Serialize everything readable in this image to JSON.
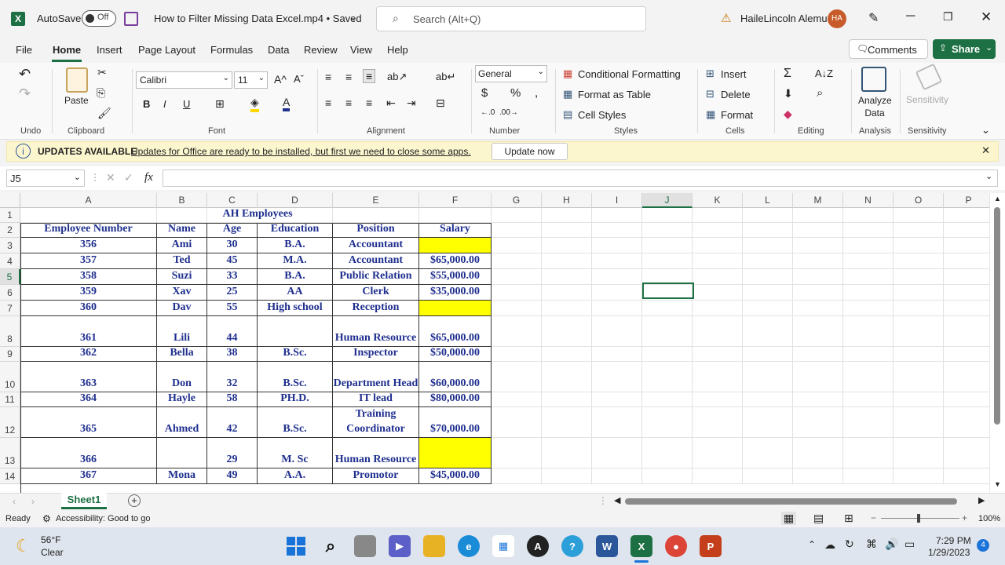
{
  "titlebar": {
    "app_icon": "excel-icon",
    "autosave_label": "AutoSave",
    "autosave_state": "Off",
    "doc_title": "How to Filter Missing Data  Excel.mp4 • Saved",
    "search_placeholder": "Search (Alt+Q)",
    "user_name": "HaileLincoln Alemu",
    "user_initials": "HA"
  },
  "tabs": [
    "File",
    "Home",
    "Insert",
    "Page Layout",
    "Formulas",
    "Data",
    "Review",
    "View",
    "Help"
  ],
  "active_tab": "Home",
  "comments_label": "Comments",
  "share_label": "Share",
  "ribbon": {
    "undo_group": "Undo",
    "clipboard_group": "Clipboard",
    "paste_label": "Paste",
    "font_group": "Font",
    "font_name": "Calibri",
    "font_size": "11",
    "alignment_group": "Alignment",
    "number_group": "Number",
    "number_format": "General",
    "styles_group": "Styles",
    "conditional_formatting": "Conditional Formatting",
    "format_as_table": "Format as Table",
    "cell_styles": "Cell Styles",
    "cells_group": "Cells",
    "insert": "Insert",
    "delete": "Delete",
    "format": "Format",
    "editing_group": "Editing",
    "analysis_group": "Analysis",
    "analyze_data": "Analyze Data",
    "sensitivity_group": "Sensitivity",
    "sensitivity": "Sensitivity"
  },
  "message_bar": {
    "title": "UPDATES AVAILABLE",
    "text": "Updates for Office are ready to be installed, but first we need to close some apps.",
    "button": "Update now"
  },
  "formula_bar": {
    "name_box": "J5",
    "fx": "fx",
    "content": ""
  },
  "columns": [
    "A",
    "B",
    "C",
    "D",
    "E",
    "F",
    "G",
    "H",
    "I",
    "J",
    "K",
    "L",
    "M",
    "N",
    "O",
    "P"
  ],
  "rows": [
    {
      "n": "1",
      "cells": [
        "",
        "",
        "AH Employees",
        "",
        "",
        ""
      ]
    },
    {
      "n": "2",
      "cells": [
        "Employee Number",
        "Name",
        "Age",
        "Education",
        "Position",
        "Salary"
      ]
    },
    {
      "n": "3",
      "cells": [
        "356",
        "Ami",
        "30",
        "B.A.",
        "Accountant",
        ""
      ]
    },
    {
      "n": "4",
      "cells": [
        "357",
        "Ted",
        "45",
        "M.A.",
        "Accountant",
        "$65,000.00"
      ]
    },
    {
      "n": "5",
      "cells": [
        "358",
        "Suzi",
        "33",
        "B.A.",
        "Public Relation",
        "$55,000.00"
      ]
    },
    {
      "n": "6",
      "cells": [
        "359",
        "Xav",
        "25",
        "AA",
        "Clerk",
        "$35,000.00"
      ]
    },
    {
      "n": "7",
      "cells": [
        "360",
        "Dav",
        "55",
        "High school",
        "Reception",
        ""
      ]
    },
    {
      "n": "8",
      "cells": [
        "361",
        "Lili",
        "44",
        "",
        "Human Resource",
        "$65,000.00"
      ]
    },
    {
      "n": "9",
      "cells": [
        "362",
        "Bella",
        "38",
        "B.Sc.",
        "Inspector",
        "$50,000.00"
      ]
    },
    {
      "n": "10",
      "cells": [
        "363",
        "Don",
        "32",
        "B.Sc.",
        "Department Head",
        "$60,000.00"
      ]
    },
    {
      "n": "11",
      "cells": [
        "364",
        "Hayle",
        "58",
        "PH.D.",
        "IT lead",
        "$80,000.00"
      ]
    },
    {
      "n": "12",
      "cells": [
        "365",
        "Ahmed",
        "42",
        "B.Sc.",
        "Training Coordinator",
        "$70,000.00"
      ]
    },
    {
      "n": "13",
      "cells": [
        "366",
        "",
        "29",
        "M. Sc",
        "Human Resource",
        ""
      ]
    },
    {
      "n": "14",
      "cells": [
        "367",
        "Mona",
        "49",
        "A.A.",
        "Promotor",
        "$45,000.00"
      ]
    }
  ],
  "highlight_color": "#ffff00",
  "selected_cell": "J5",
  "sheet_tab": "Sheet1",
  "status": {
    "ready": "Ready",
    "accessibility": "Accessibility: Good to go",
    "zoom": "100%"
  },
  "taskbar": {
    "weather_temp": "56°F",
    "weather_desc": "Clear",
    "time": "7:29 PM",
    "date": "1/29/2023",
    "notifications": "4"
  }
}
